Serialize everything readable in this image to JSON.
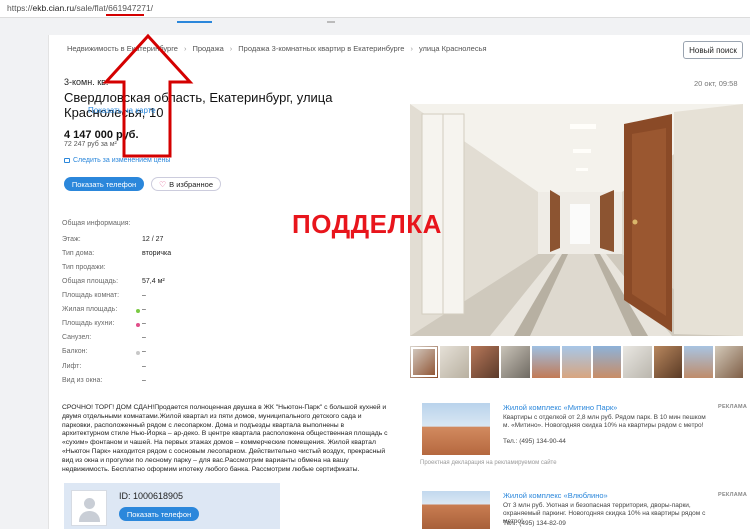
{
  "browser": {
    "url_scheme": "https://",
    "url_host": "ekb.cian.ru",
    "url_path": "/sale/flat/661947271/"
  },
  "breadcrumb": [
    "Недвижимость в Екатеринбурге",
    "Продажа",
    "Продажа 3-комнатных квартир в Екатеринбурге",
    "улица Краснолесья"
  ],
  "new_search_label": "Новый поиск",
  "listing": {
    "rooms": "3-комн. кв.",
    "date": "20 окт, 09:58",
    "address": "Свердловская область, Екатеринбург, улица Краснолесья, 10",
    "show_on_map": "Показать на карте",
    "price": "4 147 000 руб.",
    "price_per_m2": "72 247 руб за м²",
    "follow_price": "Следить за изменением цены",
    "phone_button": "Показать телефон",
    "favorite_button": "В избранное"
  },
  "params": [
    {
      "label": "Общая информация:",
      "value": "",
      "dot": ""
    },
    {
      "label": "Этаж:",
      "value": "12 / 27",
      "dot": ""
    },
    {
      "label": "Тип дома:",
      "value": "вторичка",
      "dot": ""
    },
    {
      "label": "Тип продажи:",
      "value": "",
      "dot": ""
    },
    {
      "label": "Общая площадь:",
      "value": "57,4 м²",
      "dot": ""
    },
    {
      "label": "Площадь комнат:",
      "value": "–",
      "dot": ""
    },
    {
      "label": "Жилая площадь:",
      "value": "–",
      "dot": "#7ac943"
    },
    {
      "label": "Площадь кухни:",
      "value": "–",
      "dot": "#e04e89"
    },
    {
      "label": "Санузел:",
      "value": "–",
      "dot": ""
    },
    {
      "label": "Балкон:",
      "value": "–",
      "dot": "#c8c8c8"
    },
    {
      "label": "Лифт:",
      "value": "–",
      "dot": ""
    },
    {
      "label": "Вид из окна:",
      "value": "–",
      "dot": ""
    }
  ],
  "description": "СРОЧНО! ТОРГ! ДОМ СДАН!Продается полноценная двушка в ЖК \"Ньютон-Парк\" с большой кухней и двумя отдельными комнатами.Жилой квартал из пяти домов, муниципального детского сада и парковки, расположенный рядом с лесопарком. Дома и подъезды квартала выполнены в архитектурном стиле Нью-Йорка – ар-деко. В центре квартала расположена общественная площадь с «сухим» фонтаном и чашей. На первых этажах домов – коммерческие помещения. Жилой квартал «Ньютон Парк» находится рядом с сосновым лесопарком. Действительно чистый воздух, прекрасный вид из окна и прогулки по лесному парку – для вас.Рассмотрим варианты обмена на вашу недвижимость. Бесплатно оформим ипотеку любого банка. Рассмотрим любые сертификаты.",
  "agent": {
    "id": "ID: 1000618905",
    "phone_button": "Показать телефон"
  },
  "overlay_text": "ПОДДЕЛКА",
  "ads": [
    {
      "title": "Жилой комплекс «Митино Парк»",
      "text": "Квартиры с отделкой от 2,8 млн руб. Рядом парк. В 10 мин пешком м. «Митино». Новогодняя скидка 10% на квартиры рядом с метро!",
      "tel": "Тел.: (495) 134-90-44",
      "tag": "РЕКЛАМА"
    },
    {
      "title": "Жилой комплекс «Влюблино»",
      "text": "От 3 млн руб. Уютная и безопасная территория, дворы-парки, охраняемый паркинг. Новогодняя скидка 10% на квартиры рядом с метро!",
      "tel": "Тел.: (495) 134-82-09",
      "tag": "РЕКЛАМА"
    }
  ],
  "ad_note": "Проектная декларация на рекламируемом сайте",
  "colors": {
    "accent": "#2b87db",
    "warning": "#e8151c"
  }
}
